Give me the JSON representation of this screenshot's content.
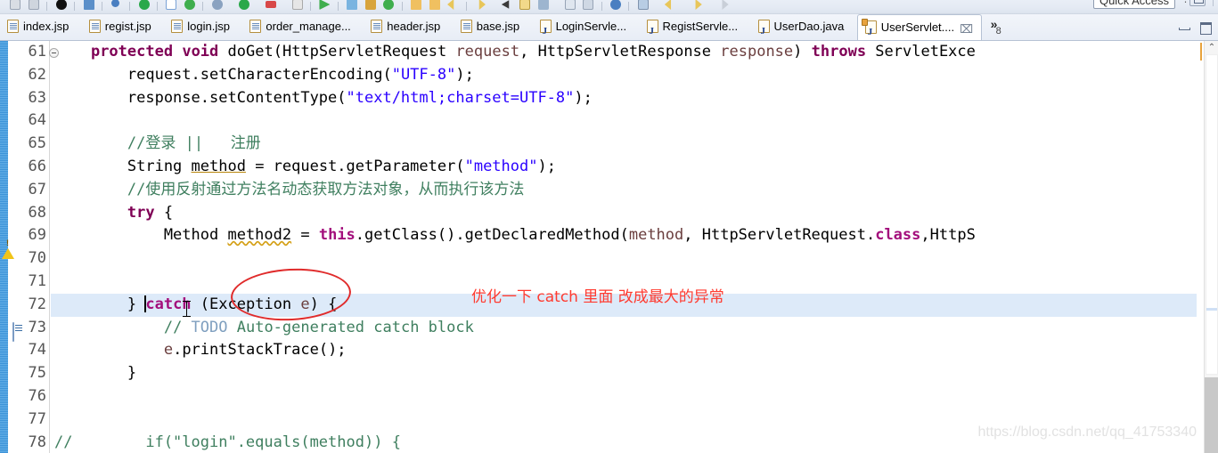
{
  "window": {
    "quick_access": "Quick Access",
    "minimize_label": "minimize",
    "maximize_label": "maximize"
  },
  "toolbar": {
    "icons": [
      "save-icon",
      "save-all-icon",
      "separator",
      "debug-icon",
      "separator",
      "terminate-icon",
      "separator",
      "search-icon",
      "separator",
      "validate-icon",
      "separator",
      "new-class-icon",
      "refresh-icon",
      "separator",
      "ant-icon",
      "separator",
      "check-icon",
      "separator",
      "server-icon",
      "separator",
      "browser-icon",
      "separator",
      "run-icon",
      "separator",
      "folder-icon",
      "book-icon",
      "publish-icon",
      "separator",
      "open-folder-icon",
      "open-folder-icon2",
      "undo-icon",
      "separator",
      "redo-icon",
      "separator",
      "pin-icon",
      "separator",
      "view-icon",
      "list-icon",
      "separator",
      "globe-icon",
      "separator",
      "perspective-icon",
      "separator",
      "back-icon",
      "forward-icon",
      "separator",
      "arrow-icon"
    ]
  },
  "tabs": {
    "items": [
      {
        "label": "index.jsp",
        "type": "jsp",
        "active": false,
        "dirty": false
      },
      {
        "label": "regist.jsp",
        "type": "jsp",
        "active": false,
        "dirty": false
      },
      {
        "label": "login.jsp",
        "type": "jsp",
        "active": false,
        "dirty": false
      },
      {
        "label": "order_manage...",
        "type": "jsp",
        "active": false,
        "dirty": false
      },
      {
        "label": "header.jsp",
        "type": "jsp",
        "active": false,
        "dirty": false
      },
      {
        "label": "base.jsp",
        "type": "jsp",
        "active": false,
        "dirty": false
      },
      {
        "label": "LoginServle...",
        "type": "java",
        "active": false,
        "dirty": false
      },
      {
        "label": "RegistServle...",
        "type": "java",
        "active": false,
        "dirty": false
      },
      {
        "label": "UserDao.java",
        "type": "java",
        "active": false,
        "dirty": false
      },
      {
        "label": "UserServlet....",
        "type": "java",
        "active": true,
        "dirty": false
      }
    ],
    "close_glyph": "⌧",
    "overflow_chevron": "»",
    "overflow_count": "8"
  },
  "editor": {
    "first_line": 61,
    "highlighted_line": 72,
    "lines": [
      {
        "n": 61,
        "fold": true,
        "marker": "",
        "text": "    protected void doGet(HttpServletRequest request, HttpServletResponse response) throws ServletExce"
      },
      {
        "n": 62,
        "fold": false,
        "marker": "",
        "text": "        request.setCharacterEncoding(\"UTF-8\");"
      },
      {
        "n": 63,
        "fold": false,
        "marker": "",
        "text": "        response.setContentType(\"text/html;charset=UTF-8\");"
      },
      {
        "n": 64,
        "fold": false,
        "marker": "",
        "text": ""
      },
      {
        "n": 65,
        "fold": false,
        "marker": "",
        "text": "        //登录 ||   注册"
      },
      {
        "n": 66,
        "fold": false,
        "marker": "",
        "text": "        String method = request.getParameter(\"method\");"
      },
      {
        "n": 67,
        "fold": false,
        "marker": "",
        "text": "        //使用反射通过方法名动态获取方法对象，从而执行该方法"
      },
      {
        "n": 68,
        "fold": false,
        "marker": "",
        "text": "        try {"
      },
      {
        "n": 69,
        "fold": false,
        "marker": "warn",
        "text": "            Method method2 = this.getClass().getDeclaredMethod(method, HttpServletRequest.class,HttpS"
      },
      {
        "n": 70,
        "fold": false,
        "marker": "",
        "text": ""
      },
      {
        "n": 71,
        "fold": false,
        "marker": "",
        "text": ""
      },
      {
        "n": 72,
        "fold": false,
        "marker": "",
        "text": "        } catch (Exception e) {"
      },
      {
        "n": 73,
        "fold": false,
        "marker": "todo",
        "text": "            // TODO Auto-generated catch block"
      },
      {
        "n": 74,
        "fold": false,
        "marker": "",
        "text": "            e.printStackTrace();"
      },
      {
        "n": 75,
        "fold": false,
        "marker": "",
        "text": "        }"
      },
      {
        "n": 76,
        "fold": false,
        "marker": "",
        "text": ""
      },
      {
        "n": 77,
        "fold": false,
        "marker": "",
        "text": ""
      },
      {
        "n": 78,
        "fold": false,
        "marker": "",
        "text": "//        if(\"login\".equals(method)) {"
      }
    ]
  },
  "annotation": {
    "text": "优化一下 catch 里面 改成最大的异常",
    "color": "#ff3b30",
    "ellipse_target": "Exception"
  },
  "watermark": {
    "text": "https://blog.csdn.net/qq_41753340",
    "color": "#e2e2e2"
  },
  "colors": {
    "keyword": "#7f0055",
    "string": "#2a00ff",
    "comment": "#3f7f5f",
    "todo_tag": "#7f9fbf",
    "field": "#6a3e3e",
    "line_highlight": "#ddeaf9",
    "change_bar": "#3c93d8",
    "annotation_red": "#ff3b30"
  },
  "scrollbar": {
    "up_arrow": "⌃",
    "position_hint": "40"
  }
}
